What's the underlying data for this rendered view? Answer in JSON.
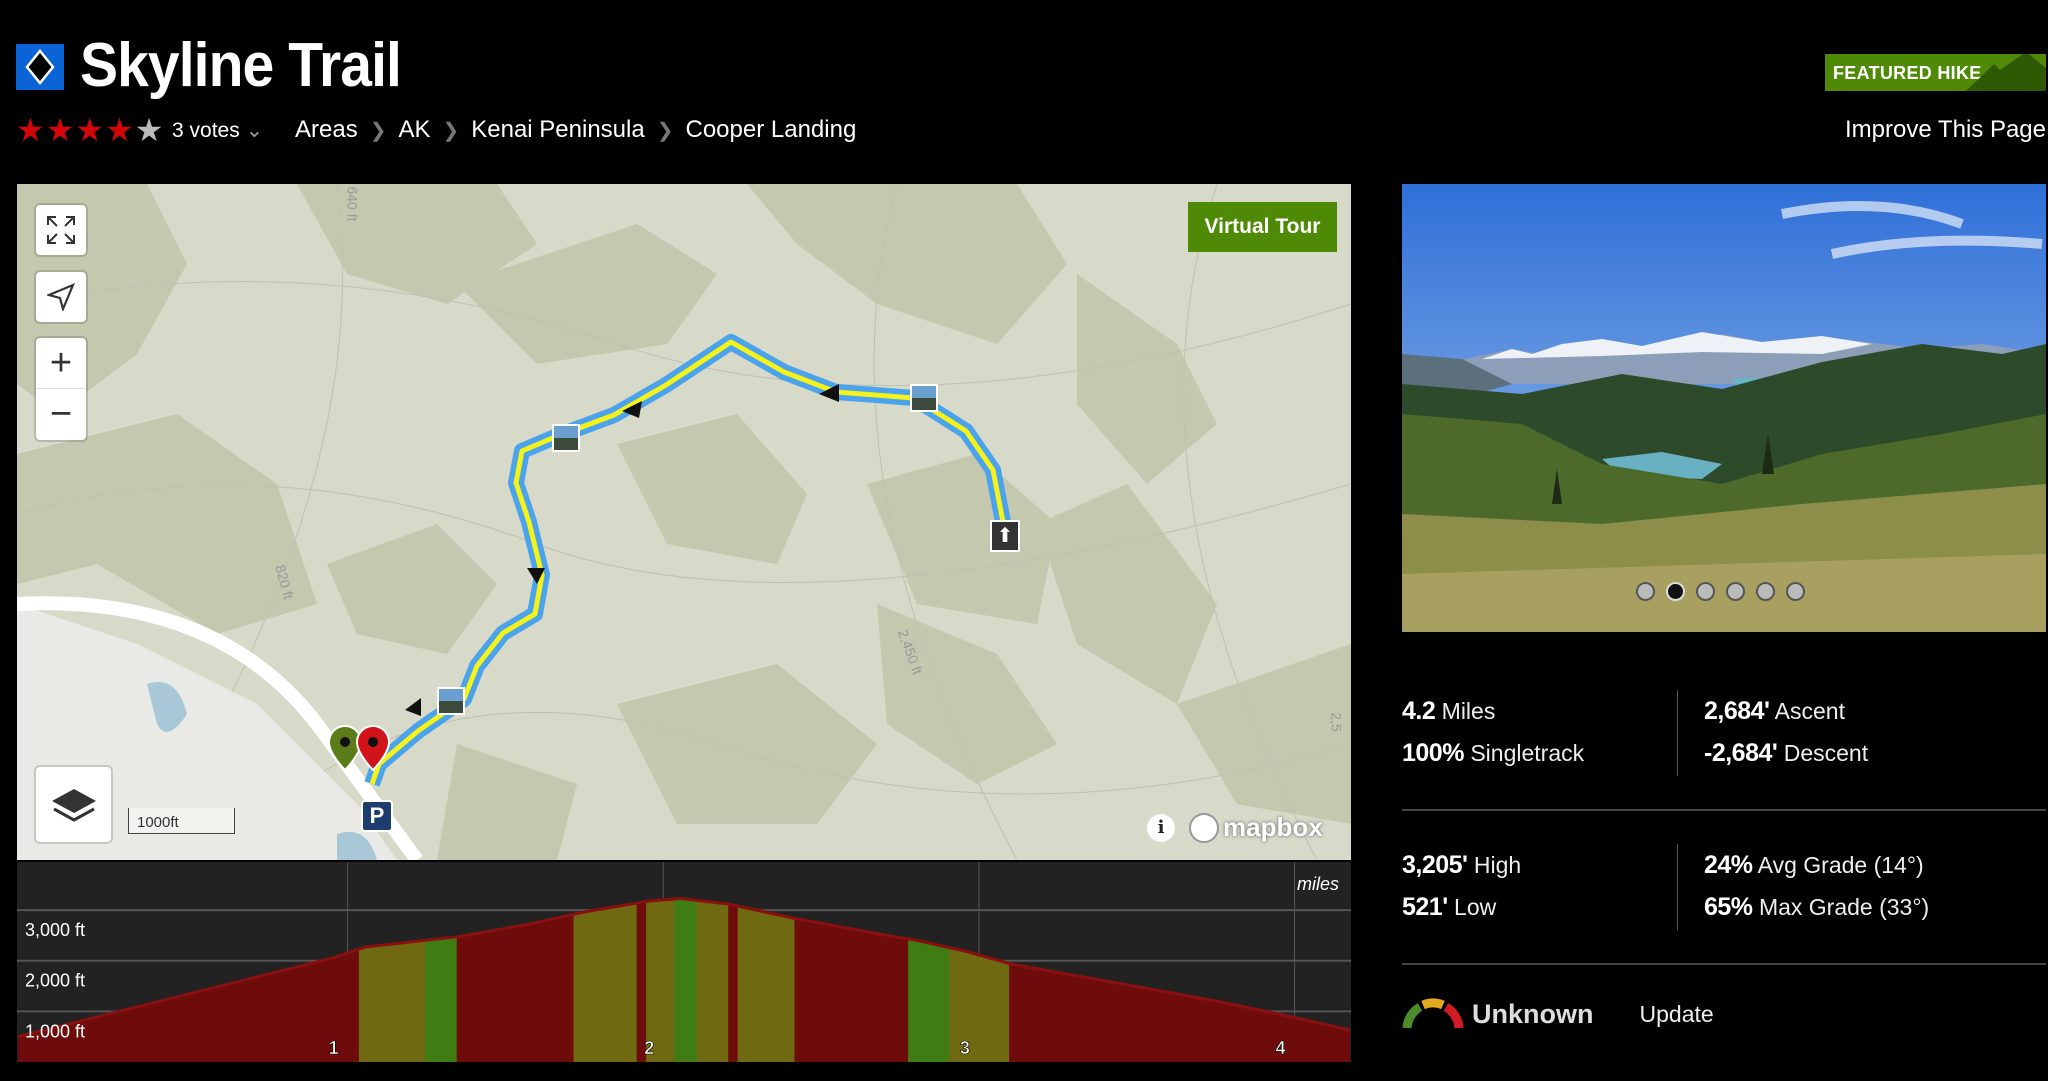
{
  "header": {
    "title": "Skyline Trail",
    "difficulty_icon": "blue-diamond-icon",
    "rating": {
      "stars": 4,
      "max": 5,
      "votes_label": "3 votes"
    },
    "breadcrumbs": [
      "Areas",
      "AK",
      "Kenai Peninsula",
      "Cooper Landing"
    ],
    "featured_badge": "FEATURED HIKE",
    "improve_link": "Improve This Page"
  },
  "map": {
    "virtual_tour": "Virtual Tour",
    "scale_label": "1000ft",
    "contour_labels": [
      "640 ft",
      "820 ft",
      "2,450 ft",
      "2,5"
    ],
    "attribution": "mapbox",
    "parking_label": "P",
    "controls": [
      "fullscreen-icon",
      "locate-icon",
      "zoom-in-icon",
      "zoom-out-icon",
      "layers-icon",
      "info-icon"
    ],
    "colors": {
      "trail": "#f4f21a",
      "trail_casing": "#4aa3ec",
      "water": "#a8c8d8"
    }
  },
  "chart_data": {
    "type": "area",
    "xlabel": "miles",
    "ylabel": "",
    "x_ticks": [
      "1",
      "2",
      "3",
      "4"
    ],
    "y_ticks": [
      "1,000 ft",
      "2,000 ft",
      "3,000 ft"
    ],
    "xlim": [
      0,
      4.22
    ],
    "ylim": [
      0,
      3950
    ],
    "grid": true,
    "x": [
      0,
      0.25,
      0.5,
      0.75,
      1.0,
      1.1,
      1.4,
      1.6,
      1.8,
      2.0,
      2.1,
      2.25,
      2.45,
      2.7,
      2.85,
      3.0,
      3.15,
      3.5,
      3.8,
      4.0,
      4.22
    ],
    "y": [
      500,
      890,
      1280,
      1670,
      2060,
      2270,
      2480,
      2700,
      2970,
      3180,
      3230,
      3120,
      2850,
      2560,
      2400,
      2190,
      1930,
      1540,
      1200,
      940,
      630
    ],
    "grade_segments": [
      {
        "from": 0,
        "to": 1.08,
        "grade": "steep"
      },
      {
        "from": 1.08,
        "to": 1.29,
        "grade": "moderate"
      },
      {
        "from": 1.29,
        "to": 1.39,
        "grade": "easy"
      },
      {
        "from": 1.39,
        "to": 1.76,
        "grade": "steep"
      },
      {
        "from": 1.76,
        "to": 1.96,
        "grade": "moderate"
      },
      {
        "from": 1.96,
        "to": 1.99,
        "grade": "steep"
      },
      {
        "from": 1.99,
        "to": 2.08,
        "grade": "moderate"
      },
      {
        "from": 2.08,
        "to": 2.15,
        "grade": "easy"
      },
      {
        "from": 2.15,
        "to": 2.25,
        "grade": "moderate"
      },
      {
        "from": 2.25,
        "to": 2.28,
        "grade": "steep"
      },
      {
        "from": 2.28,
        "to": 2.46,
        "grade": "moderate"
      },
      {
        "from": 2.46,
        "to": 2.82,
        "grade": "steep"
      },
      {
        "from": 2.82,
        "to": 2.95,
        "grade": "easy"
      },
      {
        "from": 2.95,
        "to": 3.14,
        "grade": "moderate"
      },
      {
        "from": 3.14,
        "to": 4.22,
        "grade": "steep"
      }
    ],
    "grade_colors": {
      "steep": "#6e0c0c",
      "moderate": "#6f6a12",
      "easy": "#3f7c12"
    }
  },
  "photo": {
    "slides": 6,
    "active": 2
  },
  "stats": {
    "miles": {
      "value": "4.2",
      "label": "Miles"
    },
    "singletrack": {
      "value": "100%",
      "label": "Singletrack"
    },
    "ascent": {
      "value": "2,684'",
      "label": "Ascent"
    },
    "descent": {
      "value": "-2,684'",
      "label": "Descent"
    },
    "high": {
      "value": "3,205'",
      "label": "High"
    },
    "low": {
      "value": "521'",
      "label": "Low"
    },
    "avg_grade": {
      "value": "24%",
      "label": "Avg Grade (14°)"
    },
    "max_grade": {
      "value": "65%",
      "label": "Max Grade (33°)"
    }
  },
  "conditions": {
    "status": "Unknown",
    "update_label": "Update"
  }
}
